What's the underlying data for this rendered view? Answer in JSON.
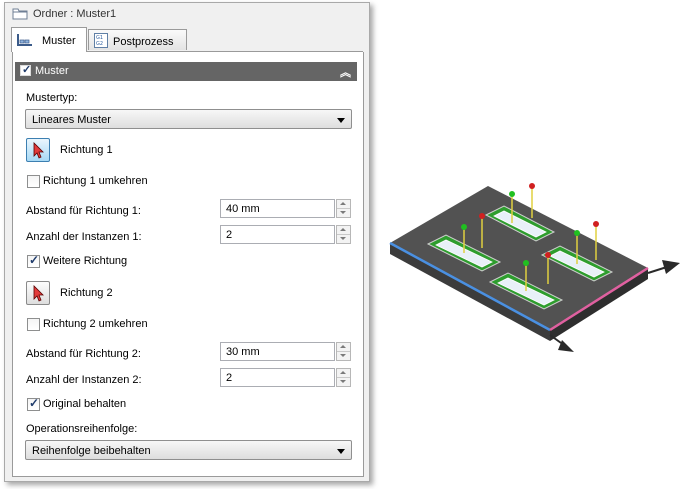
{
  "dialog": {
    "title": "Ordner : Muster1",
    "tabs": [
      {
        "label": "Muster",
        "icon": "pattern-icon",
        "active": true
      },
      {
        "label": "Postprozess",
        "icon": "postprocess-icon",
        "active": false
      }
    ],
    "section": {
      "title": "Muster",
      "checked": true,
      "collapse_icon": "double-chevron-up-icon"
    },
    "pattern_type": {
      "label": "Mustertyp:",
      "value": "Lineares Muster"
    },
    "direction1": {
      "pick_label": "Richtung 1",
      "reverse_label": "Richtung 1 umkehren",
      "reverse_checked": false,
      "spacing_label": "Abstand für Richtung 1:",
      "spacing_value": "40 mm",
      "count_label": "Anzahl der Instanzen 1:",
      "count_value": "2"
    },
    "more_direction": {
      "label": "Weitere Richtung",
      "checked": true
    },
    "direction2": {
      "pick_label": "Richtung 2",
      "reverse_label": "Richtung 2 umkehren",
      "reverse_checked": false,
      "spacing_label": "Abstand für Richtung 2:",
      "spacing_value": "30 mm",
      "count_label": "Anzahl der Instanzen 2:",
      "count_value": "2"
    },
    "keep_original": {
      "label": "Original behalten",
      "checked": true
    },
    "operation_order": {
      "label": "Operationsreihenfolge:",
      "value": "Reihenfolge beibehalten"
    }
  },
  "colors": {
    "section_header": "#656565",
    "pick_active": "#a7d9f5",
    "edge_direction1": "#4a90e2",
    "edge_direction2": "#e060a0",
    "pocket_wall": "#2e9d2e"
  },
  "viewport": {
    "content": "3d-part-with-four-pocket-pattern"
  }
}
